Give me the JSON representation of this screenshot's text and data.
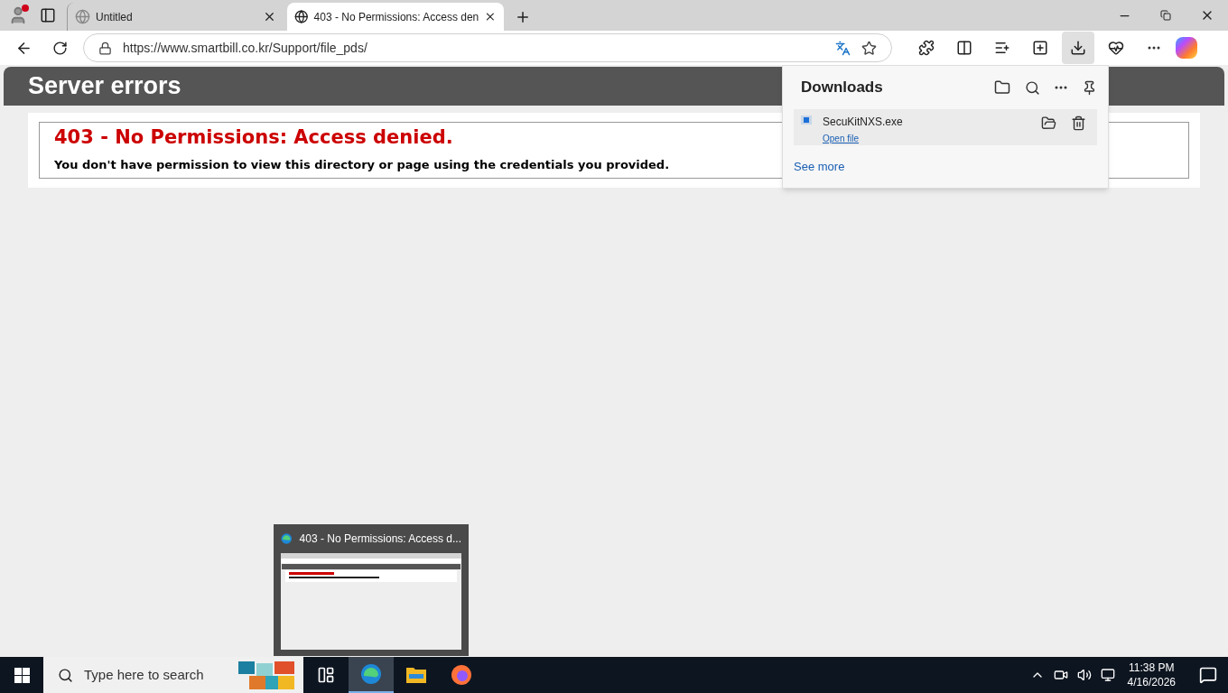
{
  "tabs": [
    {
      "title": "Untitled",
      "selected": false
    },
    {
      "title": "403 - No Permissions: Access den",
      "selected": true
    }
  ],
  "address_bar": {
    "url": "https://www.smartbill.co.kr/Support/file_pds/"
  },
  "page": {
    "header": "Server errors",
    "error_title": "403 - No Permissions: Access denied.",
    "error_message": "You don't have permission to view this directory or page using the credentials you provided."
  },
  "downloads": {
    "title": "Downloads",
    "items": [
      {
        "file_name": "SecuKitNXS.exe",
        "action": "Open file"
      }
    ],
    "see_more": "See more"
  },
  "taskbar": {
    "search_placeholder": "Type here to search",
    "apps": [
      {
        "kind": "taskview",
        "selected": false
      },
      {
        "kind": "edge",
        "selected": true
      },
      {
        "kind": "explorer",
        "selected": false
      },
      {
        "kind": "firefox",
        "selected": false
      }
    ],
    "preview_title": "403 - No Permissions: Access d...",
    "time": "11:38 PM",
    "date": "4/16/2026"
  }
}
